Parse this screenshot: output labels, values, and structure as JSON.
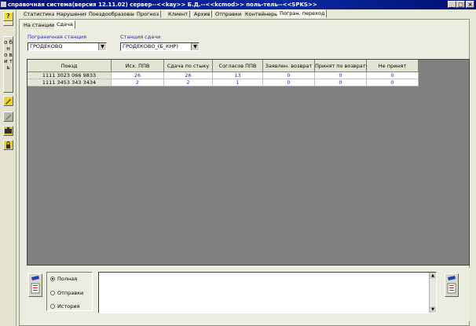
{
  "window": {
    "title": "справочная система(версия 12.11.02) сервер--<<kay>> Б.Д.--<<kcmod>> поль-тель--<<SPKS>>",
    "minimize": "_",
    "maximize": "□",
    "close": "×"
  },
  "toolbar": {
    "help_label": "?",
    "refresh_label": "о б н о в и т ь"
  },
  "tabs": [
    "Статистика",
    "Нарушения",
    "Поездообразование",
    "Прогноз",
    "Клиент",
    "Архив",
    "Отправки",
    "Контейнеры",
    "Погран. переход"
  ],
  "subtabs": [
    "На станции",
    "Сдача"
  ],
  "filters": {
    "border_station_label": "Пограничная станция",
    "border_station_value": "ГРОДЕКОВО",
    "handover_station_label": "Станция сдачи",
    "handover_station_value": "ГРОДЕКОВО_(Б_КНР)"
  },
  "table": {
    "headers": [
      "Поезд",
      "Исх. ППВ",
      "Сдача по стыку",
      "Согласов ППВ",
      "Заявлен. возврат",
      "Принят по возврату",
      "Не принят"
    ],
    "rows": [
      [
        "1111 3023 066 9833",
        "26",
        "26",
        "13",
        "0",
        "0",
        "0"
      ],
      [
        "1111 3453 343 3434",
        "2",
        "2",
        "1",
        "0",
        "0",
        "0"
      ]
    ]
  },
  "bottom": {
    "radio": [
      "Полная",
      "Отправки",
      "История"
    ],
    "selected": "Полная"
  },
  "colors": {
    "titlebar": "#0a2aa0",
    "grid_bg": "#808080",
    "value_text": "#1828a0",
    "label_text": "#2030a0"
  }
}
